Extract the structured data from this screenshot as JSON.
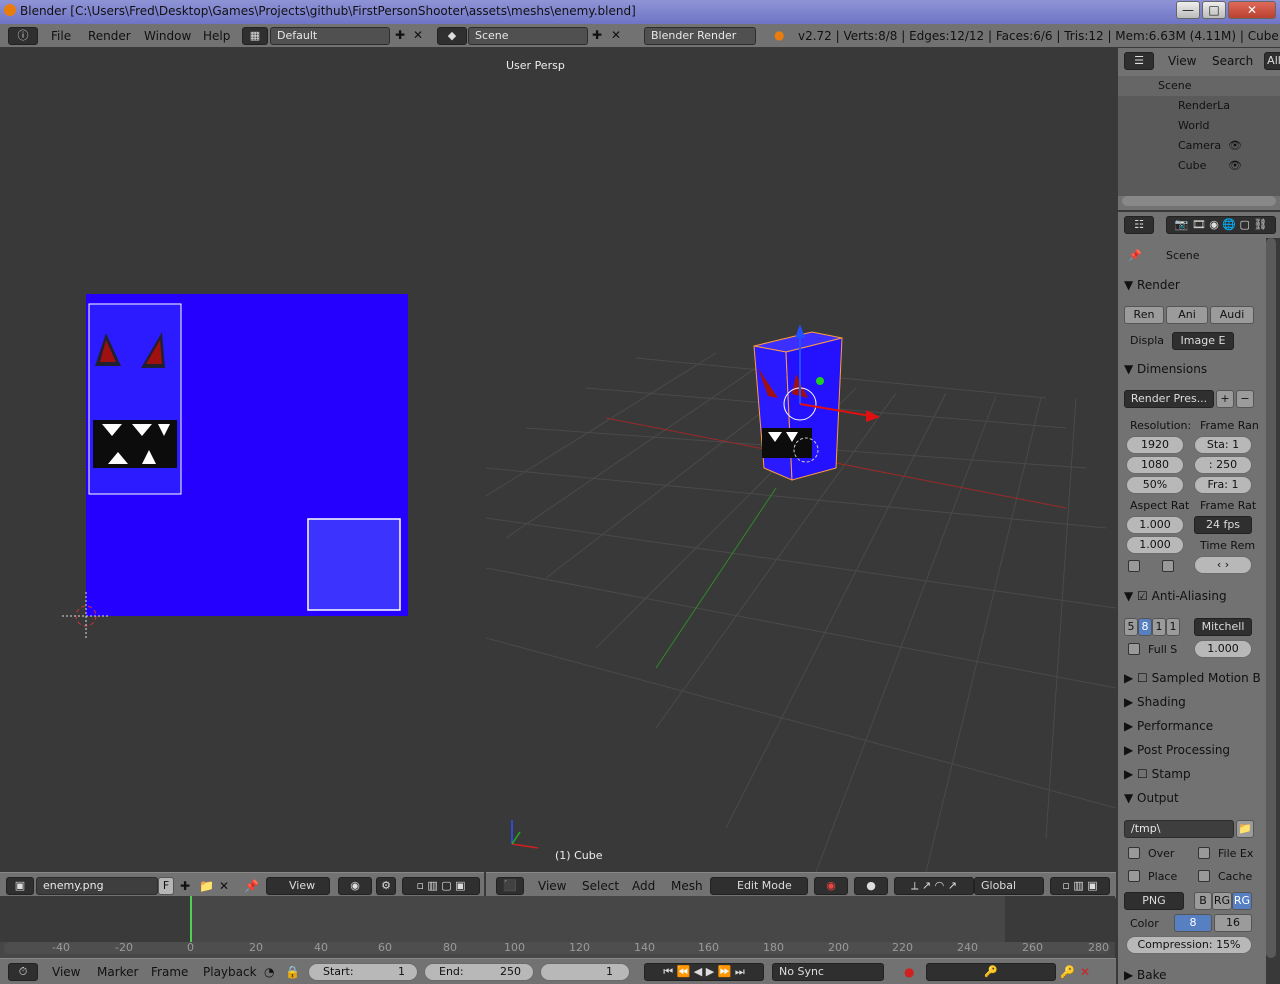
{
  "window": {
    "title": "Blender [C:\\Users\\Fred\\Desktop\\Games\\Projects\\github\\FirstPersonShooter\\assets\\meshs\\enemy.blend]",
    "minimize": "—",
    "maximize": "□",
    "close": "✕"
  },
  "topbar": {
    "menus": [
      "File",
      "Render",
      "Window",
      "Help"
    ],
    "layout": "Default",
    "scene": "Scene",
    "engine": "Blender Render",
    "info": "v2.72 | Verts:8/8 | Edges:12/12 | Faces:6/6 | Tris:12 | Mem:6.63M (4.11M) | Cube"
  },
  "image_editor": {
    "image_name": "enemy.png",
    "f_label": "F",
    "view": "View"
  },
  "viewport": {
    "label": "User Persp",
    "object_label": "(1) Cube",
    "menus": [
      "View",
      "Select",
      "Add",
      "Mesh"
    ],
    "mode": "Edit Mode",
    "orientation": "Global"
  },
  "outliner": {
    "menus": [
      "View",
      "Search",
      "All"
    ],
    "items": [
      "Scene",
      "RenderLa",
      "World",
      "Camera",
      "Cube"
    ]
  },
  "properties": {
    "context": "Scene",
    "render": {
      "title": "Render",
      "buttons": [
        "Ren",
        "Ani",
        "Audi"
      ],
      "display_label": "Displa",
      "display_value": "Image E"
    },
    "dimensions": {
      "title": "Dimensions",
      "preset": "Render Pres...",
      "res_label": "Resolution:",
      "frame_range_label": "Frame Ran",
      "res_x": "1920",
      "res_y": "1080",
      "res_pct": "50%",
      "start": "Sta: 1",
      "end": ": 250",
      "frame": "Fra: 1",
      "aspect_label": "Aspect Rat",
      "frame_rate_label": "Frame Rat",
      "aspect_x": "1.000",
      "aspect_y": "1.000",
      "fps": "24 fps",
      "time_rem": "Time Rem"
    },
    "anti_aliasing": {
      "title": "Anti-Aliasing",
      "samples": [
        "5",
        "8",
        "1",
        "1"
      ],
      "filter": "Mitchell",
      "full_s": "Full S",
      "size": "1.000"
    },
    "collapsed": [
      "Sampled Motion B",
      "Shading",
      "Performance",
      "Post Processing",
      "Stamp"
    ],
    "output": {
      "title": "Output",
      "path": "/tmp\\",
      "over": "Over",
      "file_ex": "File Ex",
      "place": "Place",
      "cache": "Cache",
      "format": "PNG",
      "bw": "B",
      "rgb": "RG",
      "rgba": "RG",
      "color_label": "Color",
      "depth_8": "8",
      "depth_16": "16",
      "compression": "Compression:  15%"
    },
    "bake": "Bake"
  },
  "timeline": {
    "ticks": [
      "-40",
      "-20",
      "0",
      "20",
      "40",
      "60",
      "80",
      "100",
      "120",
      "140",
      "160",
      "180",
      "200",
      "220",
      "240",
      "260",
      "280"
    ],
    "menus": [
      "View",
      "Marker",
      "Frame",
      "Playback"
    ],
    "start": "Start:",
    "start_val": "1",
    "end": "End:",
    "end_val": "250",
    "current": "1",
    "sync": "No Sync"
  }
}
